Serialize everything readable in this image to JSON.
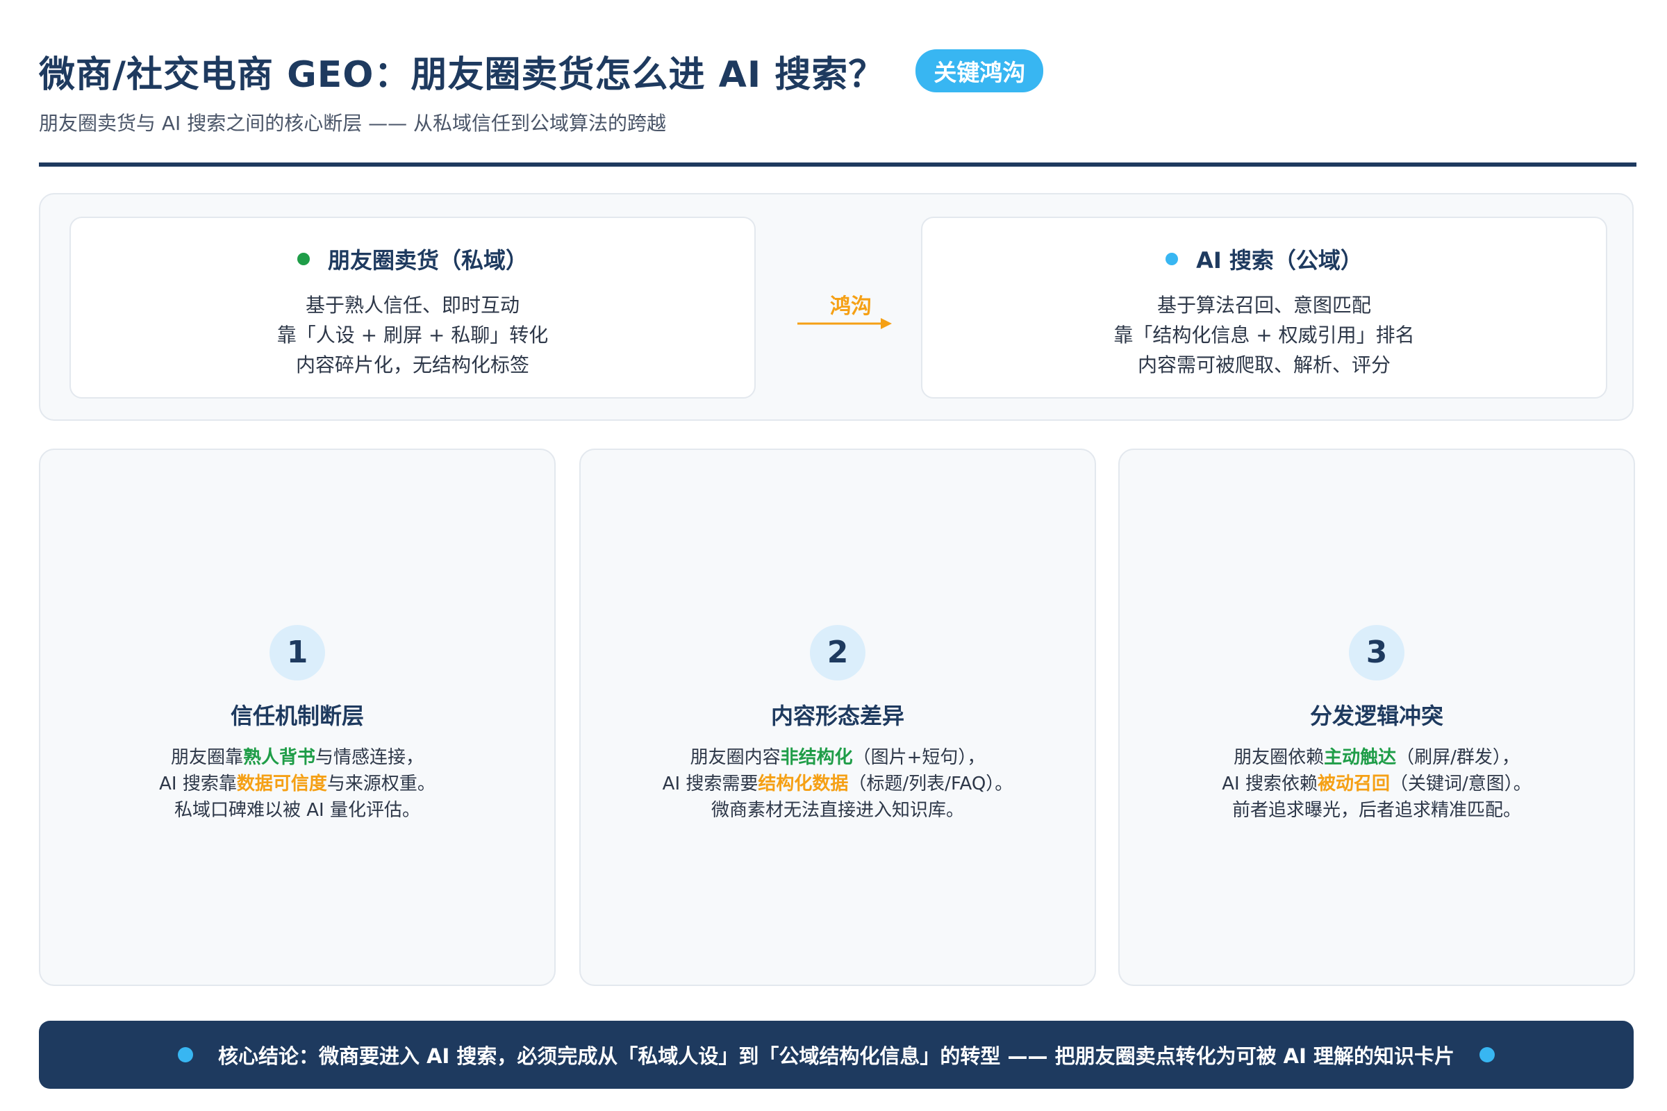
{
  "header": {
    "title": "微商/社交电商 GEO：朋友圈卖货怎么进 AI 搜索？",
    "badge": "关键鸿沟",
    "subtitle": "朋友圈卖货与 AI 搜索之间的核心断层 —— 从私域信任到公域算法的跨越"
  },
  "comparison": {
    "left": {
      "title": "朋友圈卖货（私域）",
      "dot_color": "#1f9d48",
      "lines": [
        "基于熟人信任、即时互动",
        "靠「人设 + 刷屏 + 私聊」转化",
        "内容碎片化，无结构化标签"
      ]
    },
    "gap_label": "鸿沟",
    "right": {
      "title": "AI 搜索（公域）",
      "dot_color": "#38b6f2",
      "lines": [
        "基于算法召回、意图匹配",
        "靠「结构化信息 + 权威引用」排名",
        "内容需可被爬取、解析、评分"
      ]
    }
  },
  "factors": [
    {
      "number": "1",
      "title": "信任机制断层",
      "line1": {
        "pre": "朋友圈靠",
        "hl": "熟人背书",
        "post": "与情感连接，"
      },
      "line2": {
        "pre": "AI 搜索靠",
        "hl": "数据可信度",
        "post": "与来源权重。"
      },
      "line3": "私域口碑难以被 AI 量化评估。"
    },
    {
      "number": "2",
      "title": "内容形态差异",
      "line1": {
        "pre": "朋友圈内容",
        "hl": "非结构化",
        "post": "（图片+短句），"
      },
      "line2": {
        "pre": "AI 搜索需要",
        "hl": "结构化数据",
        "post": "（标题/列表/FAQ）。"
      },
      "line3": "微商素材无法直接进入知识库。"
    },
    {
      "number": "3",
      "title": "分发逻辑冲突",
      "line1": {
        "pre": "朋友圈依赖",
        "hl": "主动触达",
        "post": "（刷屏/群发），"
      },
      "line2": {
        "pre": "AI 搜索依赖",
        "hl": "被动召回",
        "post": "（关键词/意图）。"
      },
      "line3": "前者追求曝光，后者追求精准匹配。"
    }
  ],
  "conclusion": "核心结论：微商要进入 AI 搜索，必须完成从「私域人设」到「公域结构化信息」的转型 —— 把朋友圈卖点转化为可被 AI 理解的知识卡片"
}
